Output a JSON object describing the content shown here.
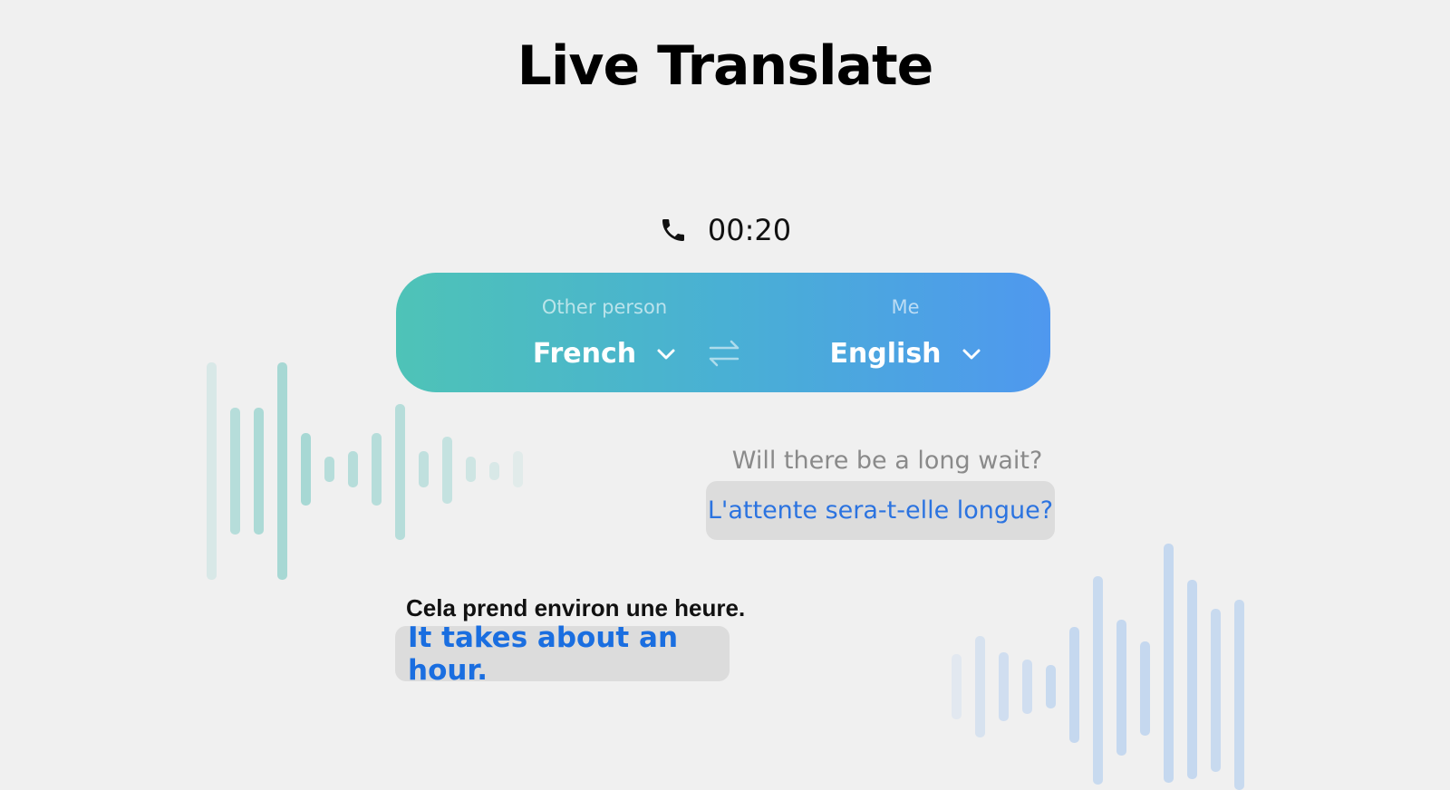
{
  "header": {
    "title": "Live Translate"
  },
  "call": {
    "duration": "00:20",
    "icon": "phone-icon"
  },
  "language_bar": {
    "other": {
      "role": "Other person",
      "language": "French"
    },
    "me": {
      "role": "Me",
      "language": "English"
    },
    "swap_icon": "swap-icon",
    "gradient_colors": [
      "#4ec3b7",
      "#4f98ef"
    ]
  },
  "conversation": {
    "outgoing": {
      "original": "Will there be a long wait?",
      "translation": "L'attente sera-t-elle longue?"
    },
    "incoming": {
      "original": "Cela prend environ une heure.",
      "translation": "It takes about an hour."
    }
  },
  "colors": {
    "background": "#f0f0f0",
    "translation_text": "#1a6ee0",
    "wave_left": "#8fd0cb",
    "wave_right": "#a8c8ef"
  }
}
